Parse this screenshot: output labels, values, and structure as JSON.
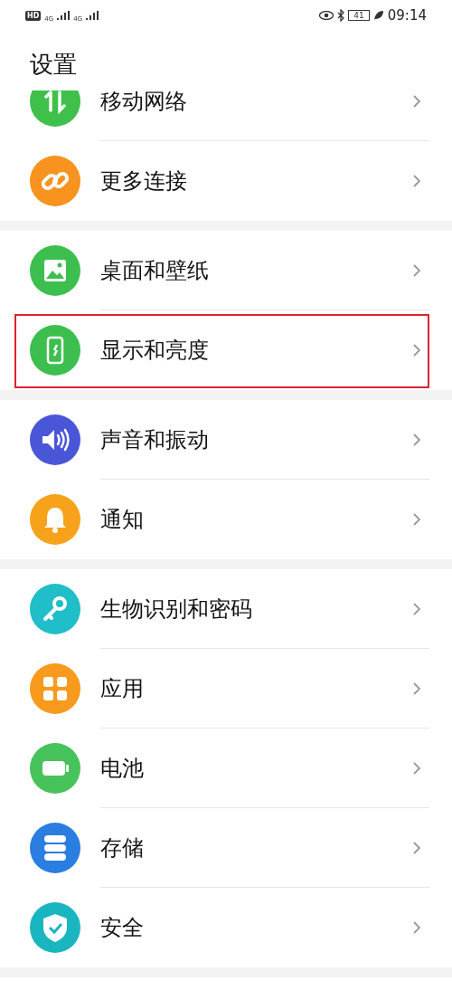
{
  "status_bar": {
    "hd": "HD",
    "signal_1": "4G",
    "signal_2": "4G",
    "battery": "41",
    "time": "09:14"
  },
  "title": "设置",
  "groups": [
    {
      "items": [
        {
          "label": "移动网络",
          "color": "#3ec04a",
          "highlighted": false,
          "partial": true
        },
        {
          "label": "更多连接",
          "color": "#f7931e",
          "highlighted": false,
          "partial": false
        }
      ]
    },
    {
      "items": [
        {
          "label": "桌面和壁纸",
          "color": "#3dbf4f",
          "highlighted": false,
          "partial": false
        },
        {
          "label": "显示和亮度",
          "color": "#3dbf4f",
          "highlighted": true,
          "partial": false
        }
      ]
    },
    {
      "items": [
        {
          "label": "声音和振动",
          "color": "#4a56d8",
          "highlighted": false,
          "partial": false
        },
        {
          "label": "通知",
          "color": "#f7a21b",
          "highlighted": false,
          "partial": false
        }
      ]
    },
    {
      "items": [
        {
          "label": "生物识别和密码",
          "color": "#1fbec9",
          "highlighted": false,
          "partial": false
        },
        {
          "label": "应用",
          "color": "#f79a1e",
          "highlighted": false,
          "partial": false
        },
        {
          "label": "电池",
          "color": "#48c25a",
          "highlighted": false,
          "partial": false
        },
        {
          "label": "存储",
          "color": "#2a7de1",
          "highlighted": false,
          "partial": false
        },
        {
          "label": "安全",
          "color": "#1ab6c0",
          "highlighted": false,
          "partial": false
        }
      ]
    }
  ]
}
